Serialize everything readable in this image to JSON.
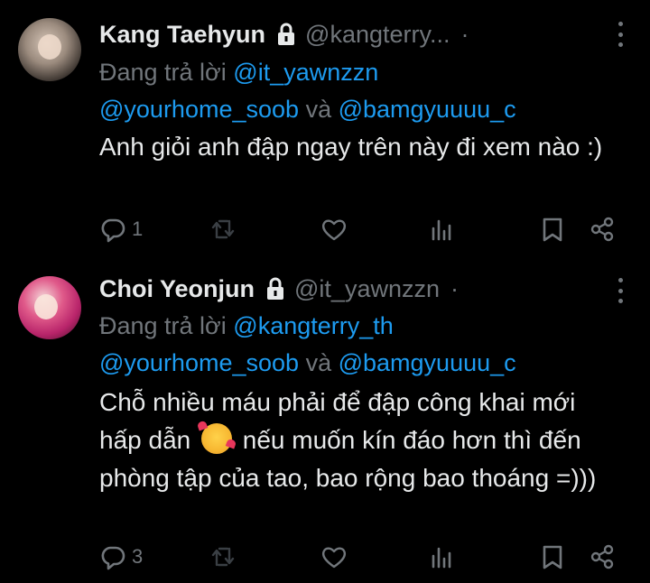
{
  "tweets": [
    {
      "name": "Kang Taehyun",
      "handle": "@kangterry...",
      "dot": "·",
      "reply_prefix": "Đang trả lời",
      "reply_to_1": "@it_yawnzzn",
      "reply_to_2": "@yourhome_soob",
      "reply_and": "và",
      "reply_to_3": "@bamgyuuuu_c",
      "text": "Anh giỏi anh đập ngay trên này đi xem nào :)",
      "reply_count": "1",
      "icons": [
        "reply-icon",
        "retweet-icon",
        "like-icon",
        "views-icon",
        "bookmark-icon",
        "share-icon"
      ]
    },
    {
      "name": "Choi Yeonjun",
      "handle": "@it_yawnzzn",
      "dot": "·",
      "reply_prefix": "Đang trả lời",
      "reply_to_1": "@kangterry_th",
      "reply_to_2": "@yourhome_soob",
      "reply_and": "và",
      "reply_to_3": "@bamgyuuuu_c",
      "text_part1": "Chỗ nhiều máu phải để đập công khai mới hấp dẫn",
      "text_part2": "nếu muốn kín đáo hơn thì đến phòng tập của tao, bao rộng bao thoáng =)))",
      "reply_count": "3",
      "icons": [
        "reply-icon",
        "retweet-icon",
        "like-icon",
        "views-icon",
        "bookmark-icon",
        "share-icon"
      ]
    }
  ],
  "colors": {
    "background": "#000000",
    "text": "#e7e9ea",
    "muted": "#71767b",
    "link": "#1d9bf0"
  }
}
